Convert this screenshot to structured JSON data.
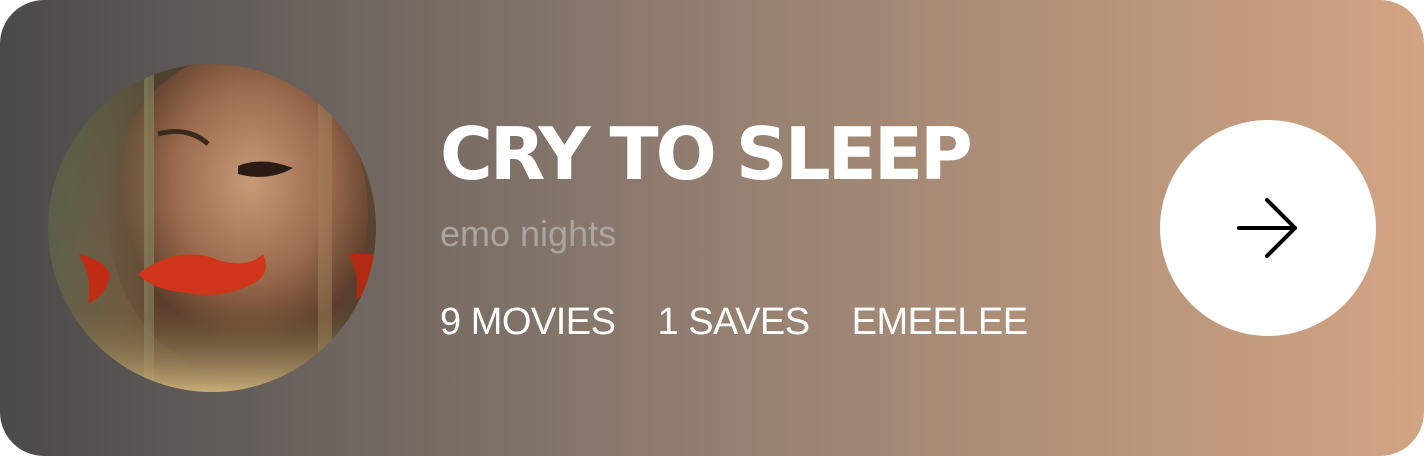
{
  "playlist": {
    "title": "CRY TO SLEEP",
    "subtitle": "emo nights",
    "stats": {
      "movies": "9 MOVIES",
      "saves": "1 SAVES",
      "author": "EMEELEE"
    },
    "cover_icon": "cover-image",
    "open_icon": "arrow-right-icon"
  },
  "colors": {
    "gradient_start": "#4a4a4a",
    "gradient_end": "#d2a483",
    "title": "#ffffff",
    "subtitle": "#a9a5a1",
    "button_bg": "#ffffff",
    "accent_fish": "#d0341a"
  }
}
